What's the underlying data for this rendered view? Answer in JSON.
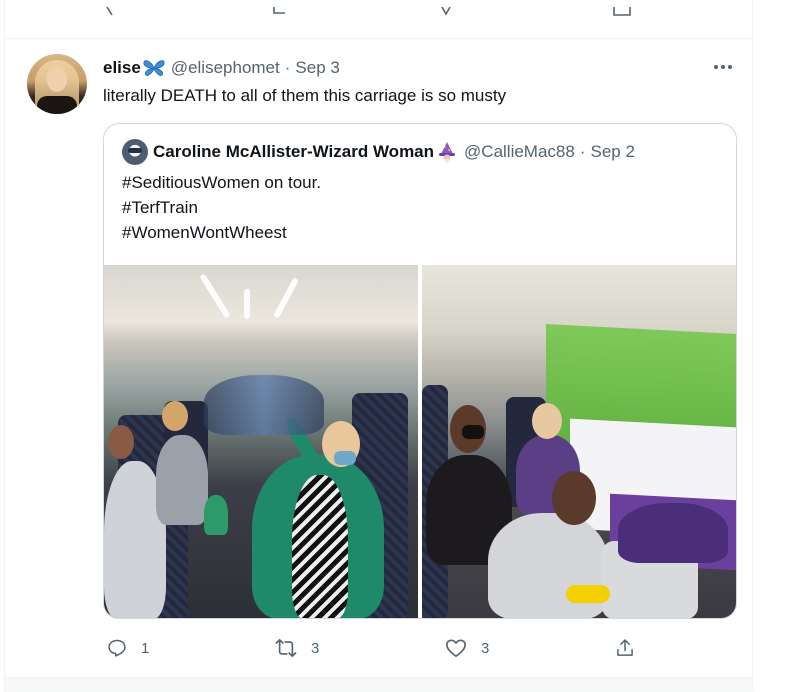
{
  "tweet": {
    "author": {
      "display_name": "elise",
      "name_emoji": "butterfly-icon",
      "handle": "@elisephomet",
      "date": "Sep 3"
    },
    "text": "literally DEATH to all of them this carriage is so musty",
    "quoted": {
      "display_name": "Caroline McAllister-Wizard Woman",
      "name_emoji": "wizard-icon",
      "handle": "@CallieMac88",
      "date": "Sep 2",
      "lines": [
        "#SeditiousWomen on tour.",
        "#TerfTrain",
        "#WomenWontWheest"
      ],
      "media": [
        "train-carriage-photo-left",
        "train-carriage-photo-right"
      ]
    },
    "actions": {
      "reply_count": "1",
      "retweet_count": "3",
      "like_count": "3"
    }
  },
  "colors": {
    "text_primary": "#0f1419",
    "text_secondary": "#536471",
    "border": "#cfd9de",
    "butterfly": "#3b8fe0",
    "flag_green": "#6cbc4b",
    "flag_purple": "#6b3f9e"
  }
}
